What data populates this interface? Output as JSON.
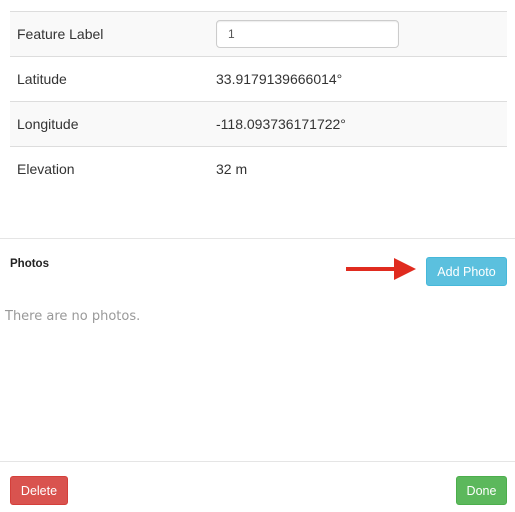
{
  "details": {
    "rows": [
      {
        "label": "Feature Label",
        "type": "input",
        "value": "1"
      },
      {
        "label": "Latitude",
        "type": "text",
        "value": "33.9179139666014°"
      },
      {
        "label": "Longitude",
        "type": "text",
        "value": "-118.093736171722°"
      },
      {
        "label": "Elevation",
        "type": "text",
        "value": "32 m"
      }
    ]
  },
  "photos": {
    "title": "Photos",
    "add_button_label": "Add Photo",
    "empty_text": "There are no photos."
  },
  "annotation": {
    "icon": "red-arrow-icon",
    "color": "#e02b1f"
  },
  "footer": {
    "delete_label": "Delete",
    "done_label": "Done"
  },
  "colors": {
    "info": "#5bc0de",
    "danger": "#d9534f",
    "success": "#5cb85c",
    "stripe": "#f9f9f9"
  }
}
